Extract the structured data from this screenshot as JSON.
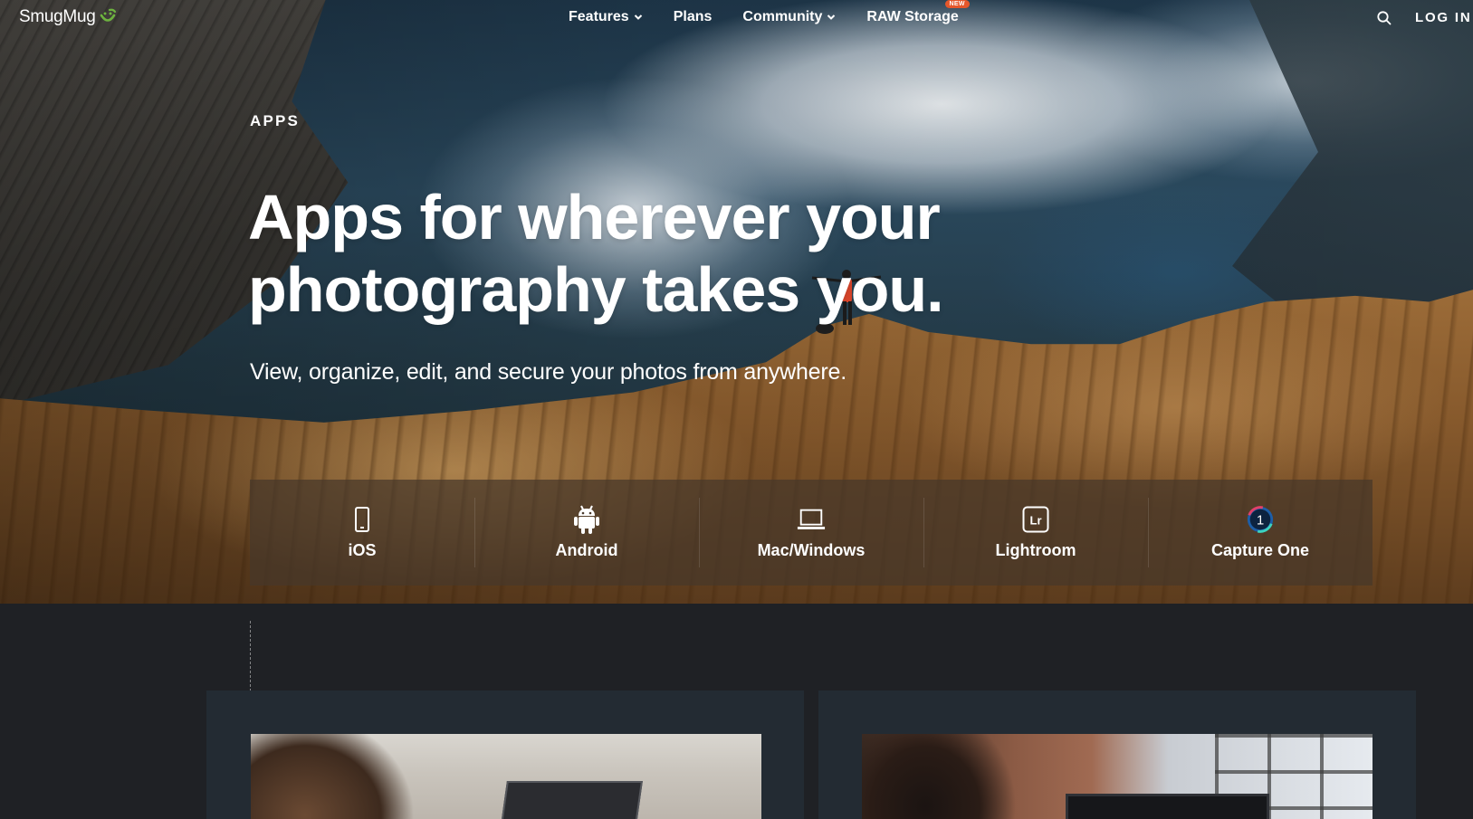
{
  "nav": {
    "logo_text": "SmugMug",
    "items": [
      {
        "label": "Features",
        "has_dropdown": true
      },
      {
        "label": "Plans",
        "has_dropdown": false
      },
      {
        "label": "Community",
        "has_dropdown": true
      },
      {
        "label": "RAW Storage",
        "has_dropdown": false,
        "badge": "NEW"
      }
    ],
    "search_icon": "search-icon",
    "login_label": "LOG IN"
  },
  "hero": {
    "eyebrow": "APPS",
    "headline_line1": "Apps for wherever your",
    "headline_line2": "photography takes you.",
    "subline": "View, organize, edit, and secure your photos from anywhere."
  },
  "apps": [
    {
      "label": "iOS",
      "icon": "phone-icon"
    },
    {
      "label": "Android",
      "icon": "android-icon"
    },
    {
      "label": "Mac/Windows",
      "icon": "laptop-icon"
    },
    {
      "label": "Lightroom",
      "icon": "lightroom-icon",
      "icon_text": "Lr"
    },
    {
      "label": "Capture One",
      "icon": "capture-one-icon",
      "icon_text": "1"
    }
  ],
  "colors": {
    "brand_green": "#6db33f",
    "badge_orange": "#e5572b",
    "page_dark": "#1f2125",
    "card_bg": "#232b33"
  }
}
